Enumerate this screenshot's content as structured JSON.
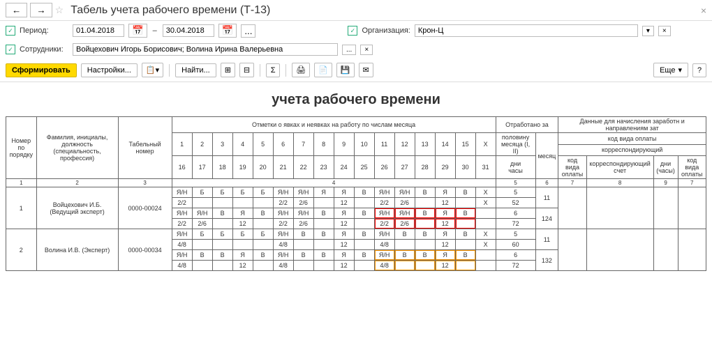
{
  "header": {
    "title": "Табель учета рабочего времени (Т-13)"
  },
  "filters": {
    "period_label": "Период:",
    "date_from": "01.04.2018",
    "date_to": "30.04.2018",
    "dash": "–",
    "org_label": "Организация:",
    "org_value": "Крон-Ц",
    "emp_label": "Сотрудники:",
    "emp_value": "Войцехович Игорь Борисович; Волина Ирина Валерьевна",
    "ellipsis": "..."
  },
  "toolbar": {
    "form": "Сформировать",
    "settings": "Настройки...",
    "find": "Найти...",
    "more": "Еще",
    "help": "?"
  },
  "report": {
    "title": "учета  рабочего времени",
    "cols": {
      "num": "Номер по порядку",
      "fio": "Фамилия, инициалы, должность (специальность, профессия)",
      "tab": "Табельный номер",
      "marks": "Отметки о явках и неявках на работу по числам месяца",
      "worked": "Отработано за",
      "half": "половину месяца (I, II)",
      "month": "месяц",
      "days": "дни",
      "hours": "часы",
      "pay": "Данные для начисления заработн и направлениям зат",
      "paycode": "код вида оплаты",
      "corr": "корреспондирующий",
      "kod": "код вида оплаты",
      "corracct": "корреспондирующий счет",
      "dayshrs": "дни (часы)"
    },
    "days1": [
      "1",
      "2",
      "3",
      "4",
      "5",
      "6",
      "7",
      "8",
      "9",
      "10",
      "11",
      "12",
      "13",
      "14",
      "15",
      "X"
    ],
    "days2": [
      "16",
      "17",
      "18",
      "19",
      "20",
      "21",
      "22",
      "23",
      "24",
      "25",
      "26",
      "27",
      "28",
      "29",
      "30",
      "31"
    ],
    "colnums": [
      "1",
      "2",
      "3",
      "4",
      "5",
      "6",
      "7",
      "8",
      "9",
      "7"
    ],
    "rows": [
      {
        "n": "1",
        "fio": "Войцехович И.Б. (Ведущий эксперт)",
        "tab": "0000-00024",
        "l1": [
          "Я/Н",
          "Б",
          "Б",
          "Б",
          "Б",
          "Я/Н",
          "Я/Н",
          "Я",
          "Я",
          "В",
          "Я/Н",
          "Я/Н",
          "В",
          "Я",
          "В",
          "X"
        ],
        "l2": [
          "2/2",
          "",
          "",
          "",
          "",
          "2/2",
          "2/6",
          "",
          "12",
          "",
          "2/2",
          "2/6",
          "",
          "12",
          "",
          "X"
        ],
        "l3": [
          "Я/Н",
          "Я/Н",
          "В",
          "Я",
          "В",
          "Я/Н",
          "Я/Н",
          "В",
          "Я",
          "В",
          "Я/Н",
          "Я/Н",
          "В",
          "Я",
          "В",
          ""
        ],
        "l4": [
          "2/2",
          "2/6",
          "",
          "12",
          "",
          "2/2",
          "2/6",
          "",
          "12",
          "",
          "2/2",
          "2/6",
          "",
          "12",
          "",
          ""
        ],
        "w": [
          "5",
          "52",
          "6",
          "72"
        ],
        "tot": [
          "11",
          "124"
        ]
      },
      {
        "n": "2",
        "fio": "Волина И.В. (Эксперт)",
        "tab": "0000-00034",
        "l1": [
          "Я/Н",
          "Б",
          "Б",
          "Б",
          "Б",
          "Я/Н",
          "В",
          "В",
          "Я",
          "В",
          "Я/Н",
          "В",
          "В",
          "Я",
          "В",
          "X"
        ],
        "l2": [
          "4/8",
          "",
          "",
          "",
          "",
          "4/8",
          "",
          "",
          "12",
          "",
          "4/8",
          "",
          "",
          "12",
          "",
          "X"
        ],
        "l3": [
          "Я/Н",
          "В",
          "В",
          "Я",
          "В",
          "Я/Н",
          "В",
          "В",
          "Я",
          "В",
          "Я/Н",
          "В",
          "В",
          "Я",
          "В",
          ""
        ],
        "l4": [
          "4/8",
          "",
          "",
          "12",
          "",
          "4/8",
          "",
          "",
          "12",
          "",
          "4/8",
          "",
          "",
          "12",
          "",
          ""
        ],
        "w": [
          "5",
          "60",
          "6",
          "72"
        ],
        "tot": [
          "11",
          "132"
        ]
      }
    ]
  }
}
